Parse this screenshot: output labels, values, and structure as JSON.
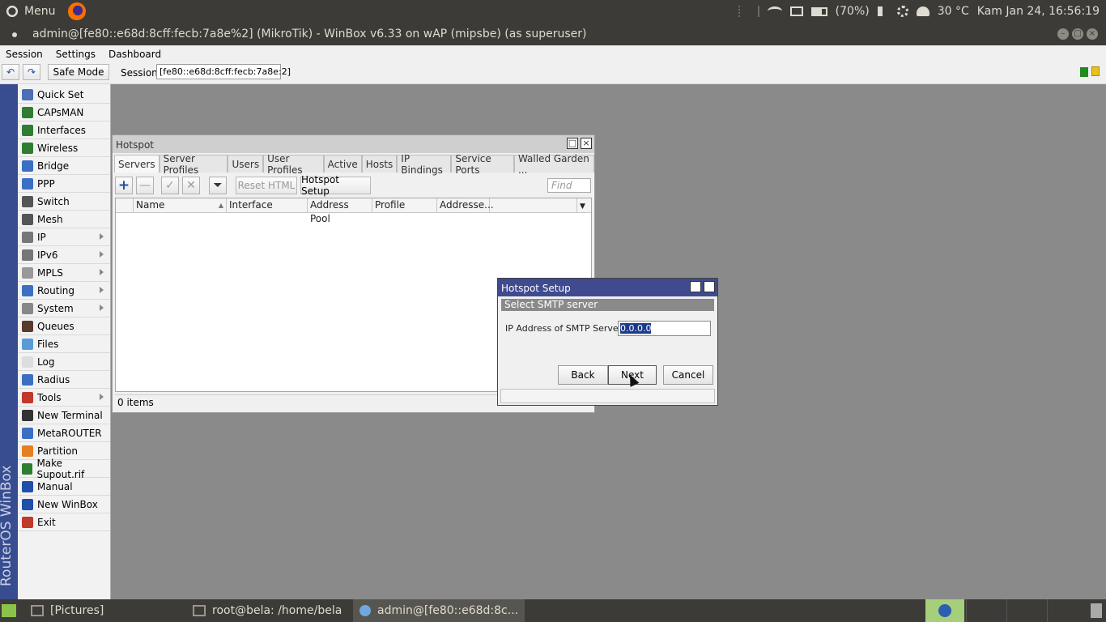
{
  "topbar": {
    "menu_label": "Menu",
    "battery": "(70%)",
    "temperature": "30 °C",
    "datetime": "Kam Jan 24, 16:56:19"
  },
  "titlebar": {
    "title": "admin@[fe80::e68d:8cff:fecb:7a8e%2] (MikroTik) - WinBox v6.33 on wAP (mipsbe) (as superuser)"
  },
  "menubar": {
    "items": [
      "Session",
      "Settings",
      "Dashboard"
    ]
  },
  "toolbar": {
    "undo_icon": "undo-icon",
    "redo_icon": "redo-icon",
    "safe_mode": "Safe Mode",
    "session_label": "Session:",
    "session_value": "[fe80::e68d:8cff:fecb:7a8e:2]"
  },
  "sidestrip": {
    "label": "RouterOS WinBox"
  },
  "sidebar": {
    "items": [
      {
        "label": "Quick Set",
        "icon": "quickset-icon",
        "color": "#4a6fb5"
      },
      {
        "label": "CAPsMAN",
        "icon": "capsman-icon",
        "color": "#2e7d32"
      },
      {
        "label": "Interfaces",
        "icon": "interfaces-icon",
        "color": "#2e7d32"
      },
      {
        "label": "Wireless",
        "icon": "wireless-icon",
        "color": "#2e7d32"
      },
      {
        "label": "Bridge",
        "icon": "bridge-icon",
        "color": "#3b6fc4"
      },
      {
        "label": "PPP",
        "icon": "ppp-icon",
        "color": "#3b6fc4"
      },
      {
        "label": "Switch",
        "icon": "switch-icon",
        "color": "#555555"
      },
      {
        "label": "Mesh",
        "icon": "mesh-icon",
        "color": "#555555"
      },
      {
        "label": "IP",
        "icon": "ip-icon",
        "color": "#777777"
      },
      {
        "label": "IPv6",
        "icon": "ipv6-icon",
        "color": "#777777"
      },
      {
        "label": "MPLS",
        "icon": "mpls-icon",
        "color": "#999999"
      },
      {
        "label": "Routing",
        "icon": "routing-icon",
        "color": "#3b6fc4"
      },
      {
        "label": "System",
        "icon": "system-icon",
        "color": "#888888"
      },
      {
        "label": "Queues",
        "icon": "queues-icon",
        "color": "#5a3a2a"
      },
      {
        "label": "Files",
        "icon": "files-icon",
        "color": "#5b9bd5"
      },
      {
        "label": "Log",
        "icon": "log-icon",
        "color": "#dddddd"
      },
      {
        "label": "Radius",
        "icon": "radius-icon",
        "color": "#3b6fc4"
      },
      {
        "label": "Tools",
        "icon": "tools-icon",
        "color": "#c0392b"
      },
      {
        "label": "New Terminal",
        "icon": "terminal-icon",
        "color": "#333333"
      },
      {
        "label": "MetaROUTER",
        "icon": "metarouter-icon",
        "color": "#3b6fc4"
      },
      {
        "label": "Partition",
        "icon": "partition-icon",
        "color": "#e67e22"
      },
      {
        "label": "Make Supout.rif",
        "icon": "supout-icon",
        "color": "#2e7d32"
      },
      {
        "label": "Manual",
        "icon": "manual-icon",
        "color": "#1f4fa8"
      },
      {
        "label": "New WinBox",
        "icon": "winbox-icon",
        "color": "#1f4fa8"
      },
      {
        "label": "Exit",
        "icon": "exit-icon",
        "color": "#c0392b"
      }
    ]
  },
  "hotspot": {
    "title": "Hotspot",
    "tabs": [
      "Servers",
      "Server Profiles",
      "Users",
      "User Profiles",
      "Active",
      "Hosts",
      "IP Bindings",
      "Service Ports",
      "Walled Garden ..."
    ],
    "reset_html": "Reset HTML",
    "hotspot_setup": "Hotspot Setup",
    "find_placeholder": "Find",
    "columns": [
      "Name",
      "Interface",
      "Address Pool",
      "Profile",
      "Addresse..."
    ],
    "status": "0 items"
  },
  "setup": {
    "title": "Hotspot Setup",
    "section": "Select SMTP server",
    "field_label": "IP Address of SMTP Serve",
    "field_value": "0.0.0.0",
    "back": "Back",
    "next": "Next",
    "cancel": "Cancel"
  },
  "taskbar": {
    "items": [
      "[Pictures]",
      "root@bela: /home/bela",
      "admin@[fe80::e68d:8c..."
    ]
  }
}
